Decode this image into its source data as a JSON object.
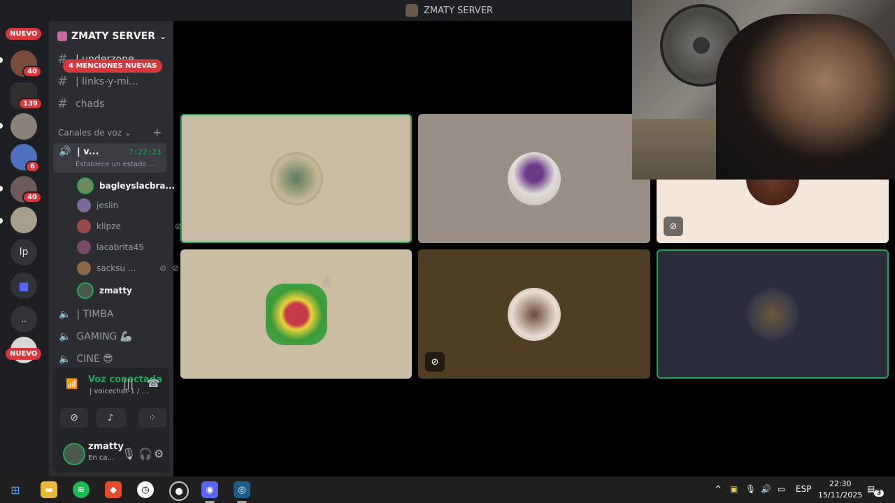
{
  "window": {
    "title": "ZMATY SERVER"
  },
  "rail": {
    "badges": [
      "40",
      "139",
      "6",
      "40"
    ],
    "new_top": "NUEVO",
    "new_bottom": "NUEVO",
    "lp_label": "lp",
    "dots_label": ".."
  },
  "sidebar": {
    "server_name": "ZMATY SERVER",
    "mentions": "4 MENCIONES NUEVAS",
    "text_channels": [
      "| underzone",
      "| links-y-mi...",
      "chads"
    ],
    "voice_category": "Canales de voz",
    "active_voice": {
      "name": "| v...",
      "timer": "7:22:23",
      "status": "Establece un estado ..."
    },
    "members": [
      "bagleyslacbra...",
      "jeslin",
      "klipze",
      "lacabrita45",
      "sacksu ...",
      "zmatty"
    ],
    "voice_channels": [
      "| TIMBA",
      "GAMING 🦾",
      "CINE 😎"
    ]
  },
  "voice_panel": {
    "status": "Voz conectada",
    "channel": "| voicechat-1 / ..."
  },
  "user": {
    "name": "zmatty",
    "status": "En ca..."
  },
  "tiles": [
    {
      "id": "t1",
      "bg": "#c9bca4",
      "speaking": true
    },
    {
      "id": "t2",
      "bg": "#9a8f86",
      "speaking": false
    },
    {
      "id": "t3",
      "bg": "#f4e6d9",
      "speaking": false,
      "muted": true
    },
    {
      "id": "t4",
      "bg": "#cbbda4",
      "speaking": false
    },
    {
      "id": "t5",
      "bg": "#4f3d24",
      "speaking": false,
      "deafened": true
    },
    {
      "id": "t6",
      "bg": "#2b2d3a",
      "speaking": true
    }
  ],
  "taskbar": {
    "lang": "ESP",
    "time": "22:30",
    "date": "15/11/2025",
    "notifications": "3"
  },
  "colors": {
    "accent_green": "#23a55a",
    "badge_red": "#da373c"
  }
}
